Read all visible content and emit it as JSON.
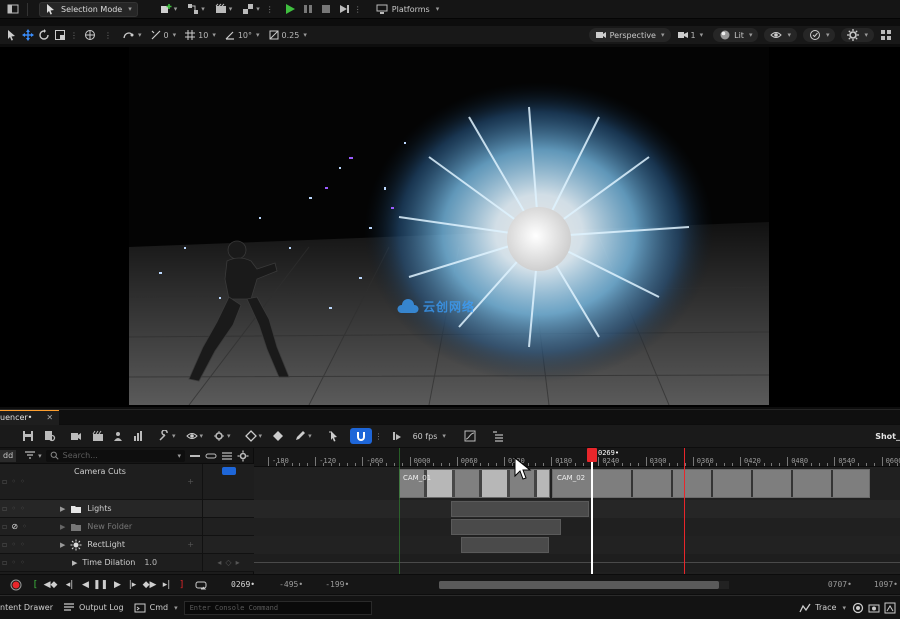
{
  "top_toolbar": {
    "selection_mode": "Selection Mode",
    "platforms": "Platforms"
  },
  "viewport_toolbar": {
    "rotation_snap_value": "0",
    "grid_snap_value": "10",
    "angle_snap_value": "10°",
    "scale_snap_value": "0.25",
    "perspective": "Perspective",
    "camera_speed": "1",
    "lit": "Lit"
  },
  "viewport": {
    "watermark": "云创网络"
  },
  "sequencer": {
    "tab_label": "uencer•",
    "add_label": "dd",
    "search_placeholder": "Search...",
    "fps_label": "60 fps",
    "shot_label": "Shot_",
    "playhead_label": "0269•",
    "tracks": [
      {
        "name": "Camera Cuts",
        "icon": "camera-cuts-icon"
      },
      {
        "name": "Lights",
        "icon": "folder-icon"
      },
      {
        "name": "New Folder",
        "icon": "folder-icon"
      },
      {
        "name": "RectLight",
        "icon": "light-icon"
      },
      {
        "name": "Time Dilation",
        "icon": "time-icon",
        "value": "1.0"
      }
    ],
    "ruler_ticks": [
      "-180",
      "-120",
      "-060",
      "0000",
      "0060",
      "0120",
      "0180",
      "0240",
      "0300",
      "0360",
      "0420",
      "0480",
      "0540",
      "0600",
      "0660"
    ],
    "camera_sections": [
      "CAM_01",
      "CAM_02"
    ]
  },
  "transport": {
    "current_frame": "0269•",
    "range_start": "-495•",
    "view_start": "-199•",
    "view_end": "0707•",
    "range_end": "1097•"
  },
  "status_bar": {
    "content_drawer": "ntent Drawer",
    "output_log": "Output Log",
    "cmd": "Cmd",
    "console_placeholder": "Enter Console Command",
    "trace": "Trace"
  },
  "colors": {
    "accent_blue": "#1e66d8",
    "playhead_red": "#e8262b",
    "play_green": "#3fbf3f",
    "tab_orange": "#ff9f2d"
  }
}
